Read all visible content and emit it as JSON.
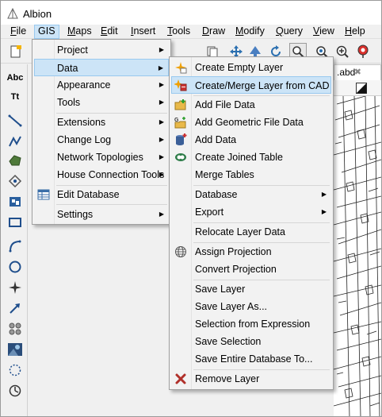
{
  "window": {
    "title": "Albion"
  },
  "menubar": {
    "items": [
      {
        "label": "File",
        "ul": "F",
        "rest": "ile"
      },
      {
        "label": "GIS",
        "ul": "",
        "rest": "GIS"
      },
      {
        "label": "Maps",
        "ul": "M",
        "rest": "aps"
      },
      {
        "label": "Edit",
        "ul": "E",
        "rest": "dit"
      },
      {
        "label": "Insert",
        "ul": "I",
        "rest": "nsert"
      },
      {
        "label": "Tools",
        "ul": "T",
        "rest": "ools"
      },
      {
        "label": "Draw",
        "ul": "D",
        "rest": "raw"
      },
      {
        "label": "Modify",
        "ul": "M",
        "rest": "odify"
      },
      {
        "label": "Query",
        "ul": "Q",
        "rest": "uery"
      },
      {
        "label": "View",
        "ul": "V",
        "rest": "iew"
      },
      {
        "label": "Help",
        "ul": "H",
        "rest": "elp"
      }
    ]
  },
  "document_tab": {
    "label": ".abd",
    "close": "✖"
  },
  "left_tools": {
    "text_tool": "Abc",
    "text_style_tool": "Tt"
  },
  "gis_menu": {
    "items": [
      {
        "label": "Project",
        "submenu": true
      },
      {
        "label": "Data",
        "submenu": true,
        "highlighted": true
      },
      {
        "label": "Appearance",
        "submenu": true
      },
      {
        "label": "Tools",
        "submenu": true
      },
      {
        "label": "Extensions",
        "submenu": true
      },
      {
        "label": "Change Log",
        "submenu": true
      },
      {
        "label": "Network Topologies",
        "submenu": true
      },
      {
        "label": "House Connection Tools",
        "submenu": true
      },
      {
        "label": "Edit Database",
        "submenu": false,
        "icon": "table-grid-icon"
      },
      {
        "label": "Settings",
        "submenu": true
      }
    ]
  },
  "data_menu": {
    "items": [
      {
        "label": "Create Empty Layer",
        "icon": "sparkle-layer-icon"
      },
      {
        "label": "Create/Merge Layer from CAD",
        "icon": "cad-layer-icon",
        "highlighted": true
      },
      {
        "label": "Add File Data",
        "icon": "folder-add-icon"
      },
      {
        "label": "Add Geometric File Data",
        "icon": "geometric-folder-icon"
      },
      {
        "label": "Add Data",
        "icon": "database-add-icon"
      },
      {
        "label": "Create Joined Table",
        "icon": "join-table-icon"
      },
      {
        "label": "Merge Tables"
      },
      {
        "label": "Database",
        "submenu": true
      },
      {
        "label": "Export",
        "submenu": true
      },
      {
        "label": "Relocate Layer Data"
      },
      {
        "label": "Assign Projection",
        "icon": "globe-icon"
      },
      {
        "label": "Convert Projection"
      },
      {
        "label": "Save Layer"
      },
      {
        "label": "Save Layer As..."
      },
      {
        "label": "Selection from Expression"
      },
      {
        "label": "Save Selection"
      },
      {
        "label": "Save Entire Database To..."
      },
      {
        "label": "Remove Layer",
        "icon": "remove-x-icon"
      }
    ]
  },
  "colors": {
    "highlight_bg": "#cce4f7",
    "highlight_border": "#99c9ef",
    "menu_bg": "#f2f2f2"
  }
}
